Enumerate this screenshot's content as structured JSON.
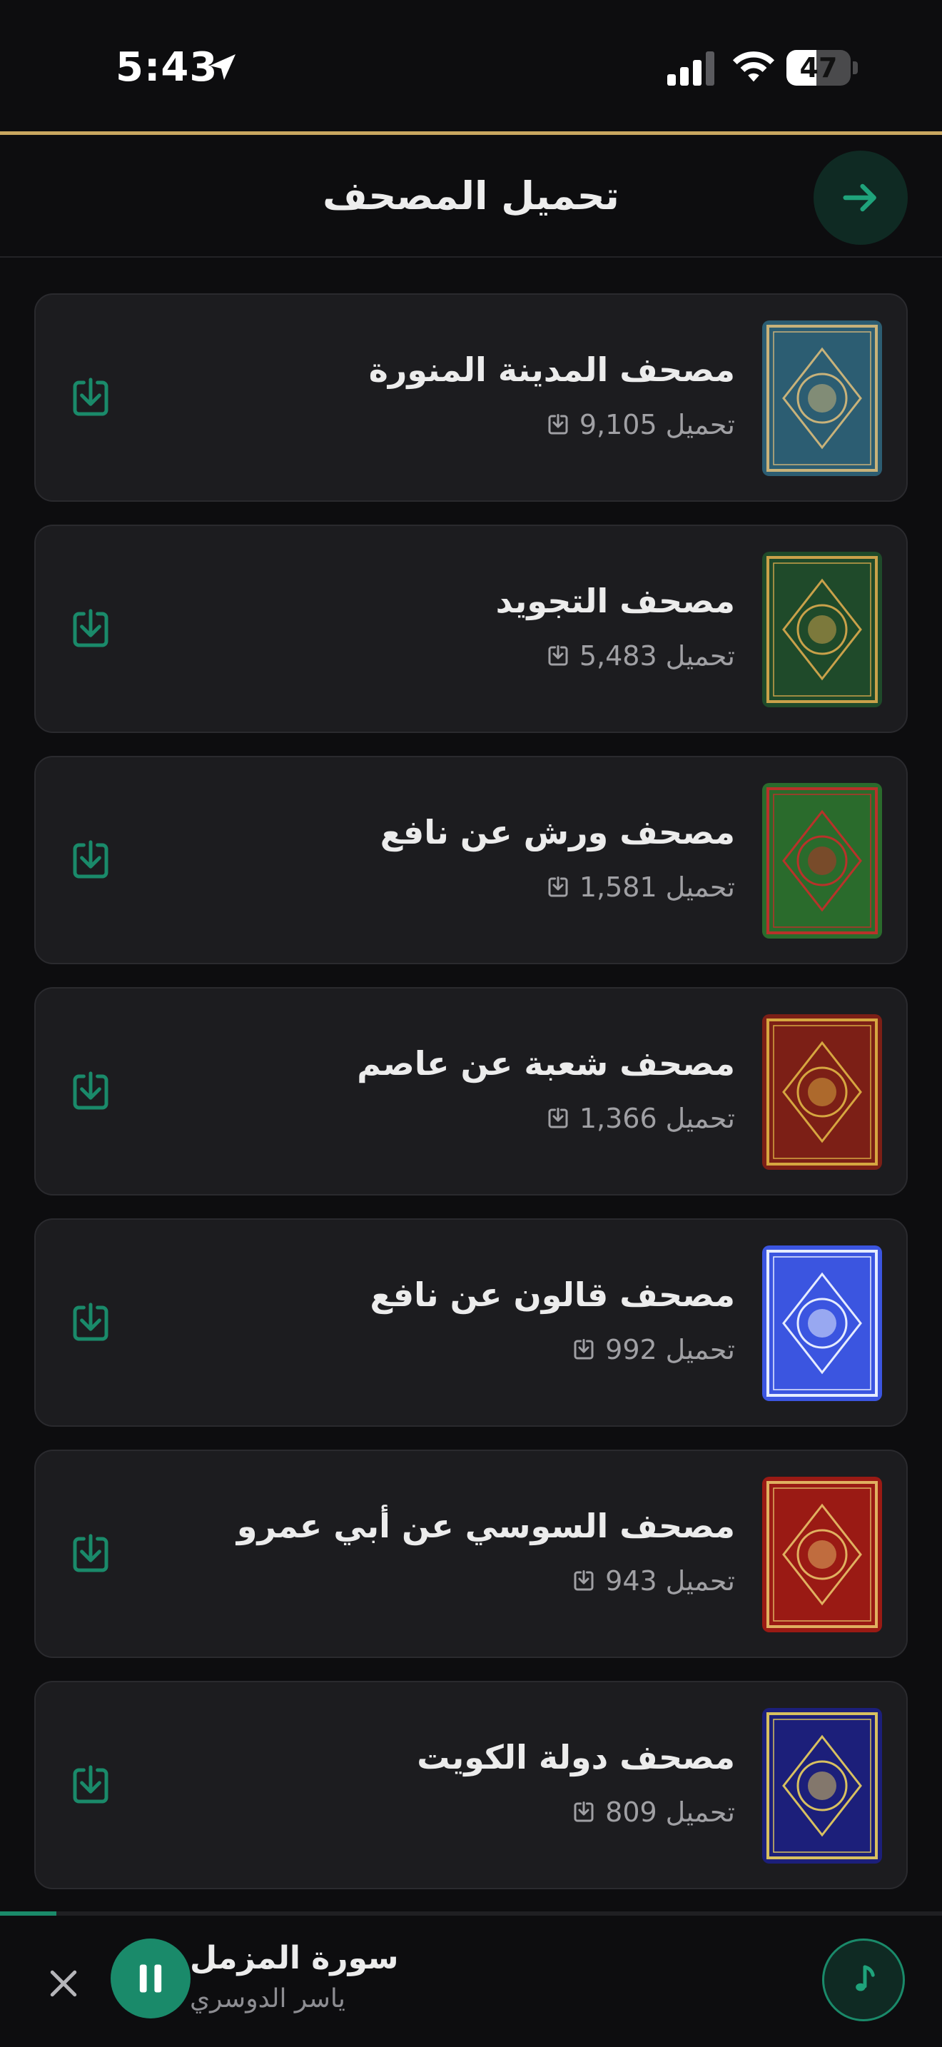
{
  "status_bar": {
    "time": "5:43",
    "battery_level": "47",
    "battery_fraction": 0.47
  },
  "header": {
    "title": "تحميل المصحف"
  },
  "theme": {
    "accent": "#1a8a6a",
    "gold": "#c9a760",
    "background": "#0d0d0f",
    "card": "#1c1c1f"
  },
  "mushafs": [
    {
      "title": "مصحف المدينة المنورة",
      "downloads": "9,105",
      "downloads_label": "تحميل",
      "cover_color": "#2c5d72",
      "cover_accent": "#c8b27a"
    },
    {
      "title": "مصحف التجويد",
      "downloads": "5,483",
      "downloads_label": "تحميل",
      "cover_color": "#1f4a2a",
      "cover_accent": "#c9a14a"
    },
    {
      "title": "مصحف ورش عن نافع",
      "downloads": "1,581",
      "downloads_label": "تحميل",
      "cover_color": "#2a6b2c",
      "cover_accent": "#b8322a"
    },
    {
      "title": "مصحف شعبة عن عاصم",
      "downloads": "1,366",
      "downloads_label": "تحميل",
      "cover_color": "#7c1f16",
      "cover_accent": "#d6a640"
    },
    {
      "title": "مصحف قالون عن نافع",
      "downloads": "992",
      "downloads_label": "تحميل",
      "cover_color": "#3b55e0",
      "cover_accent": "#e6ecff"
    },
    {
      "title": "مصحف السوسي عن أبي عمرو",
      "downloads": "943",
      "downloads_label": "تحميل",
      "cover_color": "#9a1a14",
      "cover_accent": "#e0b060"
    },
    {
      "title": "مصحف دولة الكويت",
      "downloads": "809",
      "downloads_label": "تحميل",
      "cover_color": "#1c1f7a",
      "cover_accent": "#d8c060"
    }
  ],
  "player": {
    "track_title": "سورة المزمل",
    "artist": "ياسر الدوسري",
    "progress": 0.06
  }
}
